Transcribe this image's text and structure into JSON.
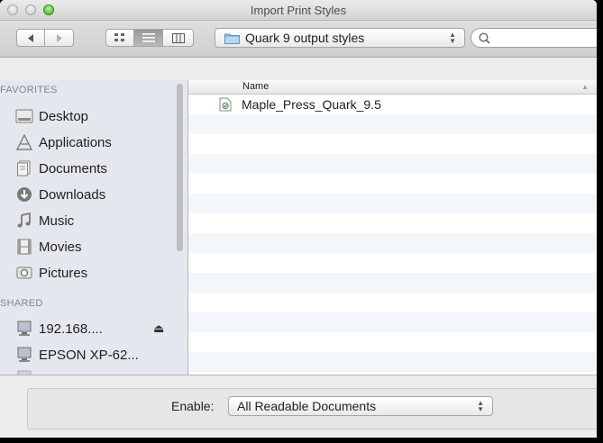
{
  "window": {
    "title": "Import Print Styles"
  },
  "toolbar": {
    "location": "Quark 9 output styles",
    "search_placeholder": ""
  },
  "sidebar": {
    "favorites_header": "FAVORITES",
    "favorites": [
      {
        "label": "Desktop",
        "icon": "desktop-icon"
      },
      {
        "label": "Applications",
        "icon": "applications-icon"
      },
      {
        "label": "Documents",
        "icon": "documents-icon"
      },
      {
        "label": "Downloads",
        "icon": "downloads-icon"
      },
      {
        "label": "Music",
        "icon": "music-icon"
      },
      {
        "label": "Movies",
        "icon": "movies-icon"
      },
      {
        "label": "Pictures",
        "icon": "pictures-icon"
      }
    ],
    "shared_header": "SHARED",
    "shared": [
      {
        "label": "192.168....",
        "icon": "network-display-icon"
      },
      {
        "label": "EPSON XP-62...",
        "icon": "network-display-icon"
      }
    ]
  },
  "file_list": {
    "column_name": "Name",
    "files": [
      {
        "name": "Maple_Press_Quark_9.5",
        "icon": "style-file-icon"
      }
    ]
  },
  "footer": {
    "enable_label": "Enable:",
    "enable_value": "All Readable Documents"
  },
  "colors": {
    "sidebar_bg": "#e4e8ee",
    "stripe": "#f3f6fa",
    "toolbar": "#d6d6d6"
  }
}
